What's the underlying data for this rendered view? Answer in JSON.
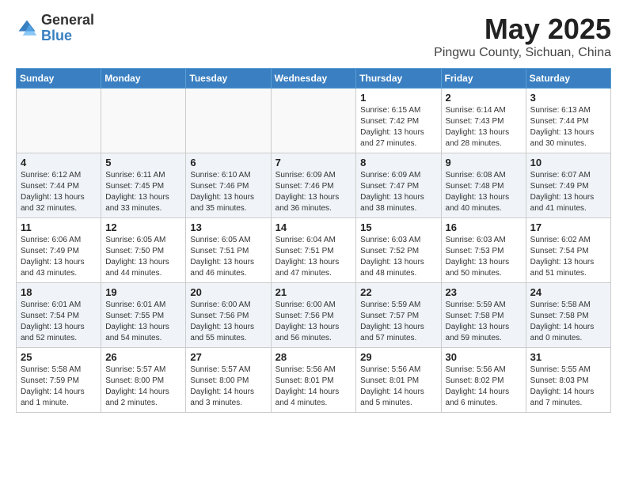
{
  "header": {
    "logo_general": "General",
    "logo_blue": "Blue",
    "month_title": "May 2025",
    "location": "Pingwu County, Sichuan, China"
  },
  "weekdays": [
    "Sunday",
    "Monday",
    "Tuesday",
    "Wednesday",
    "Thursday",
    "Friday",
    "Saturday"
  ],
  "rows": [
    {
      "shaded": false,
      "cells": [
        {
          "day": "",
          "detail": ""
        },
        {
          "day": "",
          "detail": ""
        },
        {
          "day": "",
          "detail": ""
        },
        {
          "day": "",
          "detail": ""
        },
        {
          "day": "1",
          "detail": "Sunrise: 6:15 AM\nSunset: 7:42 PM\nDaylight: 13 hours\nand 27 minutes."
        },
        {
          "day": "2",
          "detail": "Sunrise: 6:14 AM\nSunset: 7:43 PM\nDaylight: 13 hours\nand 28 minutes."
        },
        {
          "day": "3",
          "detail": "Sunrise: 6:13 AM\nSunset: 7:44 PM\nDaylight: 13 hours\nand 30 minutes."
        }
      ]
    },
    {
      "shaded": true,
      "cells": [
        {
          "day": "4",
          "detail": "Sunrise: 6:12 AM\nSunset: 7:44 PM\nDaylight: 13 hours\nand 32 minutes."
        },
        {
          "day": "5",
          "detail": "Sunrise: 6:11 AM\nSunset: 7:45 PM\nDaylight: 13 hours\nand 33 minutes."
        },
        {
          "day": "6",
          "detail": "Sunrise: 6:10 AM\nSunset: 7:46 PM\nDaylight: 13 hours\nand 35 minutes."
        },
        {
          "day": "7",
          "detail": "Sunrise: 6:09 AM\nSunset: 7:46 PM\nDaylight: 13 hours\nand 36 minutes."
        },
        {
          "day": "8",
          "detail": "Sunrise: 6:09 AM\nSunset: 7:47 PM\nDaylight: 13 hours\nand 38 minutes."
        },
        {
          "day": "9",
          "detail": "Sunrise: 6:08 AM\nSunset: 7:48 PM\nDaylight: 13 hours\nand 40 minutes."
        },
        {
          "day": "10",
          "detail": "Sunrise: 6:07 AM\nSunset: 7:49 PM\nDaylight: 13 hours\nand 41 minutes."
        }
      ]
    },
    {
      "shaded": false,
      "cells": [
        {
          "day": "11",
          "detail": "Sunrise: 6:06 AM\nSunset: 7:49 PM\nDaylight: 13 hours\nand 43 minutes."
        },
        {
          "day": "12",
          "detail": "Sunrise: 6:05 AM\nSunset: 7:50 PM\nDaylight: 13 hours\nand 44 minutes."
        },
        {
          "day": "13",
          "detail": "Sunrise: 6:05 AM\nSunset: 7:51 PM\nDaylight: 13 hours\nand 46 minutes."
        },
        {
          "day": "14",
          "detail": "Sunrise: 6:04 AM\nSunset: 7:51 PM\nDaylight: 13 hours\nand 47 minutes."
        },
        {
          "day": "15",
          "detail": "Sunrise: 6:03 AM\nSunset: 7:52 PM\nDaylight: 13 hours\nand 48 minutes."
        },
        {
          "day": "16",
          "detail": "Sunrise: 6:03 AM\nSunset: 7:53 PM\nDaylight: 13 hours\nand 50 minutes."
        },
        {
          "day": "17",
          "detail": "Sunrise: 6:02 AM\nSunset: 7:54 PM\nDaylight: 13 hours\nand 51 minutes."
        }
      ]
    },
    {
      "shaded": true,
      "cells": [
        {
          "day": "18",
          "detail": "Sunrise: 6:01 AM\nSunset: 7:54 PM\nDaylight: 13 hours\nand 52 minutes."
        },
        {
          "day": "19",
          "detail": "Sunrise: 6:01 AM\nSunset: 7:55 PM\nDaylight: 13 hours\nand 54 minutes."
        },
        {
          "day": "20",
          "detail": "Sunrise: 6:00 AM\nSunset: 7:56 PM\nDaylight: 13 hours\nand 55 minutes."
        },
        {
          "day": "21",
          "detail": "Sunrise: 6:00 AM\nSunset: 7:56 PM\nDaylight: 13 hours\nand 56 minutes."
        },
        {
          "day": "22",
          "detail": "Sunrise: 5:59 AM\nSunset: 7:57 PM\nDaylight: 13 hours\nand 57 minutes."
        },
        {
          "day": "23",
          "detail": "Sunrise: 5:59 AM\nSunset: 7:58 PM\nDaylight: 13 hours\nand 59 minutes."
        },
        {
          "day": "24",
          "detail": "Sunrise: 5:58 AM\nSunset: 7:58 PM\nDaylight: 14 hours\nand 0 minutes."
        }
      ]
    },
    {
      "shaded": false,
      "cells": [
        {
          "day": "25",
          "detail": "Sunrise: 5:58 AM\nSunset: 7:59 PM\nDaylight: 14 hours\nand 1 minute."
        },
        {
          "day": "26",
          "detail": "Sunrise: 5:57 AM\nSunset: 8:00 PM\nDaylight: 14 hours\nand 2 minutes."
        },
        {
          "day": "27",
          "detail": "Sunrise: 5:57 AM\nSunset: 8:00 PM\nDaylight: 14 hours\nand 3 minutes."
        },
        {
          "day": "28",
          "detail": "Sunrise: 5:56 AM\nSunset: 8:01 PM\nDaylight: 14 hours\nand 4 minutes."
        },
        {
          "day": "29",
          "detail": "Sunrise: 5:56 AM\nSunset: 8:01 PM\nDaylight: 14 hours\nand 5 minutes."
        },
        {
          "day": "30",
          "detail": "Sunrise: 5:56 AM\nSunset: 8:02 PM\nDaylight: 14 hours\nand 6 minutes."
        },
        {
          "day": "31",
          "detail": "Sunrise: 5:55 AM\nSunset: 8:03 PM\nDaylight: 14 hours\nand 7 minutes."
        }
      ]
    }
  ]
}
